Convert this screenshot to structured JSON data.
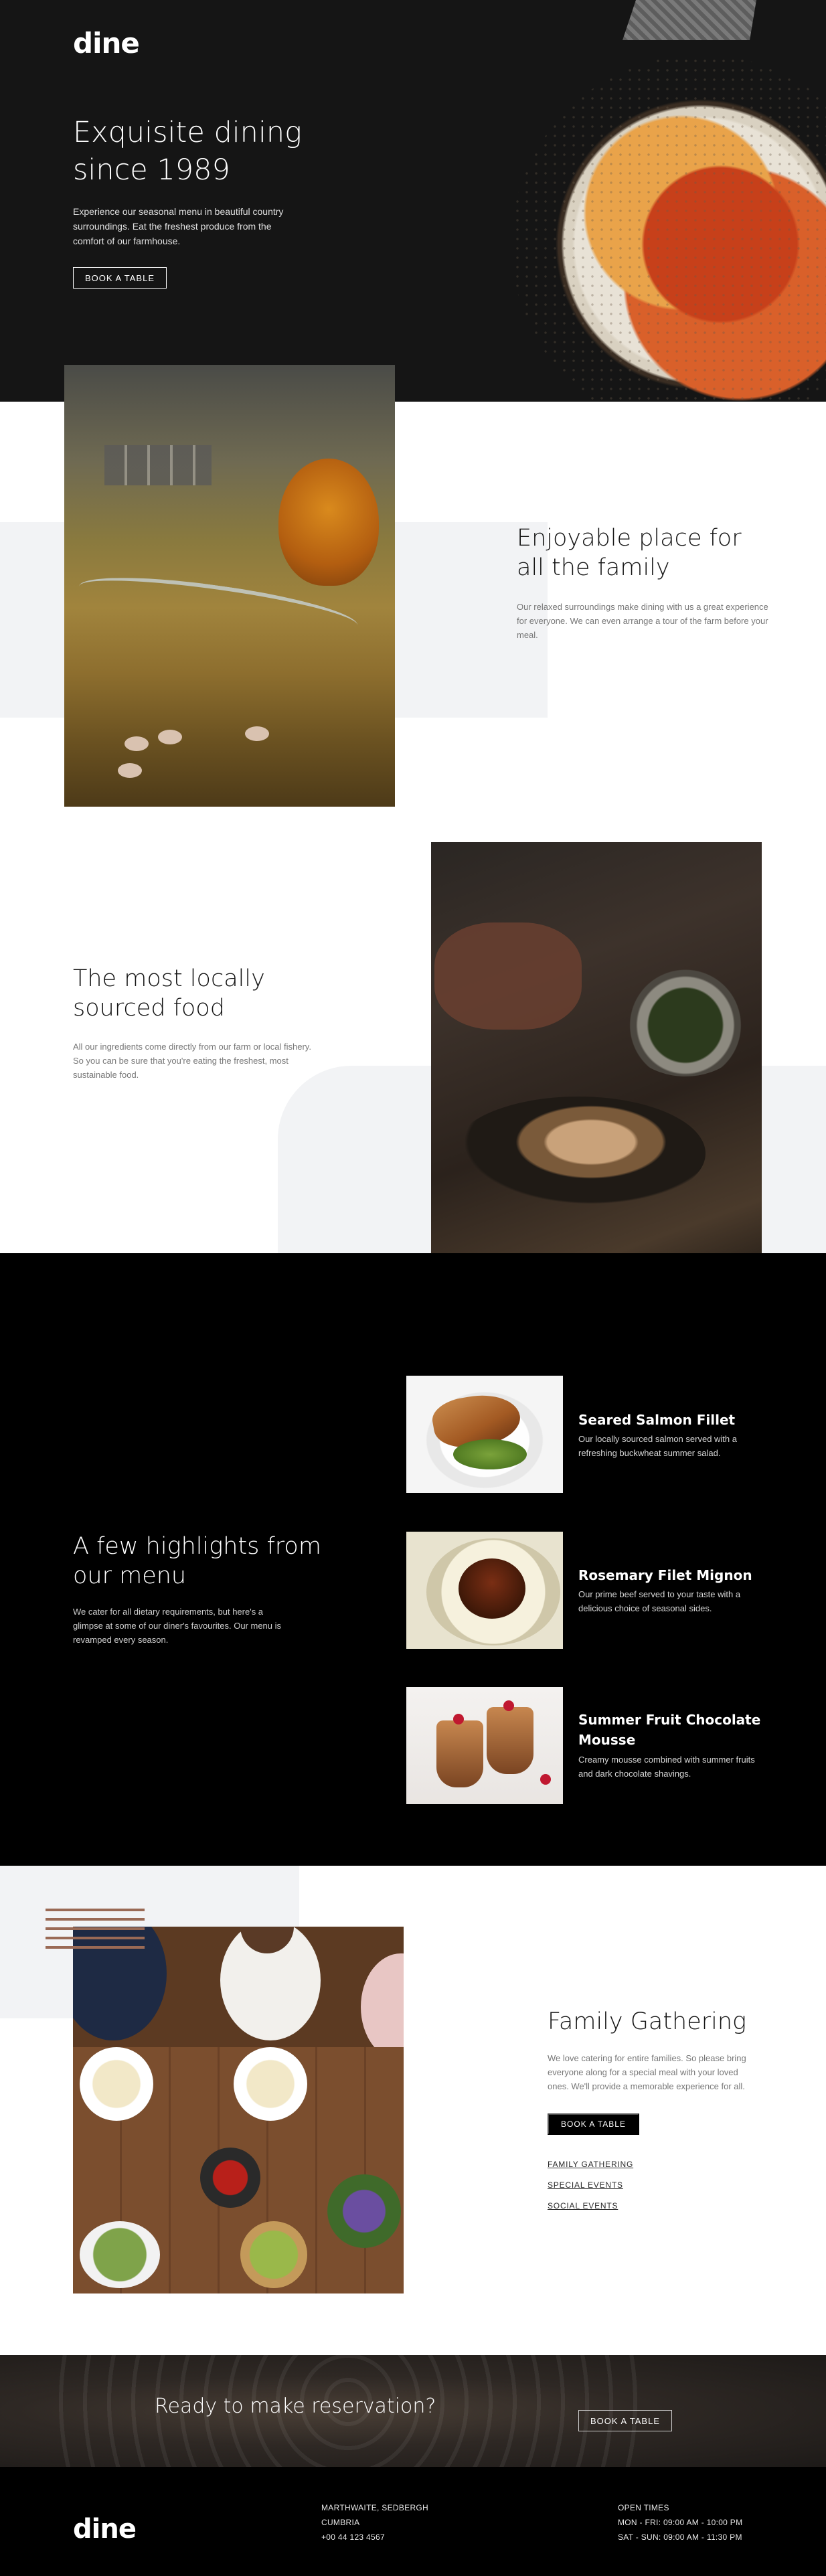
{
  "brand": {
    "logo": "dine"
  },
  "hero": {
    "title": "Exquisite dining since 1989",
    "text": "Experience our seasonal menu in beautiful country surroundings. Eat the freshest produce from the comfort of our farmhouse.",
    "button": "BOOK A TABLE"
  },
  "features": [
    {
      "title": "Enjoyable place for all the family",
      "text": "Our relaxed surroundings make dining with us a great experience for everyone. We can even arrange a tour of the farm before your meal."
    },
    {
      "title": "The most locally sourced food",
      "text": "All our ingredients come directly from our farm or local fishery. So you can be sure that you're eating the freshest, most sustainable food."
    }
  ],
  "menu": {
    "title": "A few highlights from our menu",
    "text": "We cater for all dietary requirements, but here's a glimpse at some of our diner's favourites. Our menu is revamped every season.",
    "items": [
      {
        "title": "Seared Salmon Fillet",
        "desc": "Our locally sourced salmon served with a refreshing buckwheat summer salad."
      },
      {
        "title": "Rosemary Filet Mignon",
        "desc": "Our prime beef served to your taste with a delicious choice of seasonal sides."
      },
      {
        "title": "Summer Fruit Chocolate Mousse",
        "desc": "Creamy mousse combined with summer fruits and dark chocolate shavings."
      }
    ]
  },
  "events": {
    "title": "Family Gathering",
    "text": "We love catering for entire families. So please bring everyone along for a special meal with your loved ones. We'll provide a memorable experience for all.",
    "button": "BOOK A TABLE",
    "tabs": [
      "FAMILY GATHERING",
      "SPECIAL EVENTS",
      "SOCIAL EVENTS"
    ]
  },
  "cta": {
    "text": "Ready to make reservation?",
    "button": "BOOK A TABLE"
  },
  "footer": {
    "logo": "dine",
    "address": [
      "MARTHWAITE, SEDBERGH",
      "CUMBRIA",
      "+00 44 123 4567"
    ],
    "hours": [
      "OPEN TIMES",
      "MON - FRI: 09:00 AM - 10:00 PM",
      "SAT - SUN: 09:00 AM - 11:30 PM"
    ]
  },
  "colors": {
    "dark": "#151515",
    "black": "#000000",
    "grey_block": "#f2f3f5",
    "accent_lines": "#9a6a55"
  }
}
